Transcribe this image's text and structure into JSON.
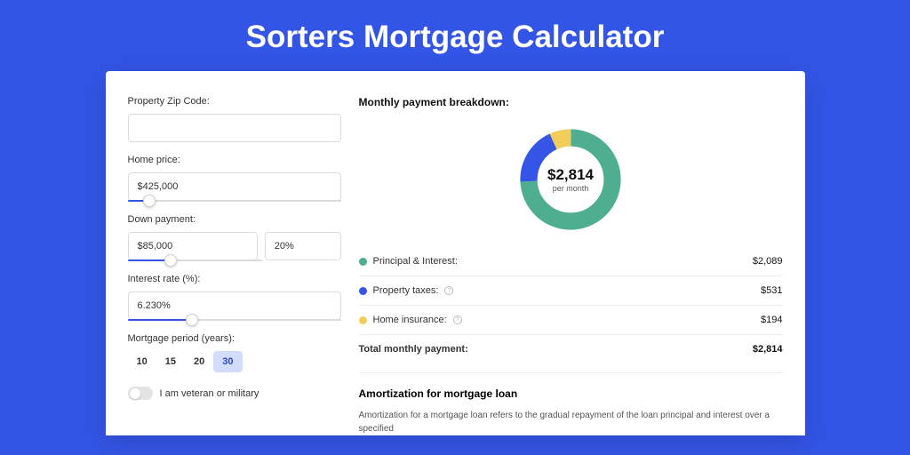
{
  "page": {
    "title": "Sorters Mortgage Calculator"
  },
  "form": {
    "zip": {
      "label": "Property Zip Code:",
      "value": ""
    },
    "price": {
      "label": "Home price:",
      "value": "$425,000",
      "slider_pct": 10
    },
    "down": {
      "label": "Down payment:",
      "amount": "$85,000",
      "pct": "20%",
      "slider_pct": 20
    },
    "rate": {
      "label": "Interest rate (%):",
      "value": "6.230%",
      "slider_pct": 30
    },
    "period": {
      "label": "Mortgage period (years):",
      "options": [
        "10",
        "15",
        "20",
        "30"
      ],
      "active": "30"
    },
    "veteran": {
      "label": "I am veteran or military",
      "on": false
    }
  },
  "breakdown": {
    "title": "Monthly payment breakdown:",
    "center_amount": "$2,814",
    "center_sub": "per month",
    "items": [
      {
        "label": "Principal & Interest:",
        "value": "$2,089",
        "color": "#4fae8f",
        "info": false
      },
      {
        "label": "Property taxes:",
        "value": "$531",
        "color": "#3455e5",
        "info": true
      },
      {
        "label": "Home insurance:",
        "value": "$194",
        "color": "#f1cd5a",
        "info": true
      }
    ],
    "total": {
      "label": "Total monthly payment:",
      "value": "$2,814"
    }
  },
  "amort": {
    "title": "Amortization for mortgage loan",
    "text": "Amortization for a mortgage loan refers to the gradual repayment of the loan principal and interest over a specified"
  },
  "chart_data": {
    "type": "pie",
    "title": "Monthly payment breakdown",
    "series": [
      {
        "name": "Principal & Interest",
        "value": 2089,
        "color": "#4fae8f"
      },
      {
        "name": "Property taxes",
        "value": 531,
        "color": "#3455e5"
      },
      {
        "name": "Home insurance",
        "value": 194,
        "color": "#f1cd5a"
      }
    ],
    "total": 2814,
    "center_label": "$2,814 per month"
  }
}
